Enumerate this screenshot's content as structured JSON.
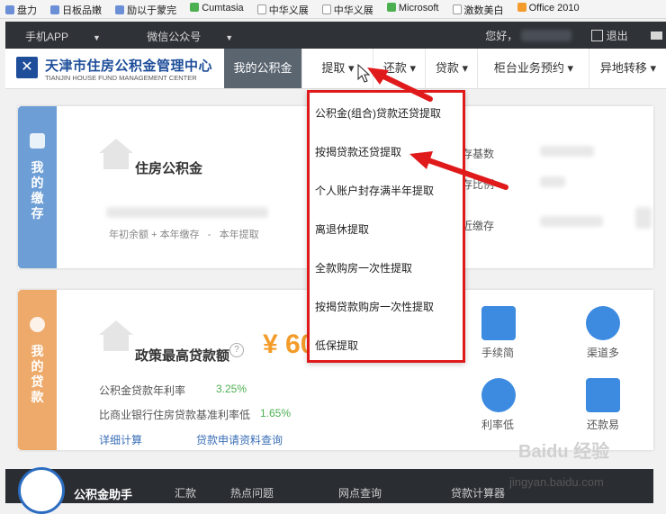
{
  "bookmarks": [
    "盘力",
    "日板品嫩",
    "励以于蒙完",
    "Cumtasia",
    "中华义展",
    "中华义展",
    "Microsoft",
    "激数美白",
    "Office 2010"
  ],
  "topbar": {
    "app_label": "手机APP",
    "wechat_label": "微信公众号",
    "greeting": "您好，",
    "logout_label": "退出"
  },
  "site": {
    "title_cn": "天津市住房公积金管理中心",
    "title_en": "TIANJIN HOUSE FUND MANAGEMENT CENTER"
  },
  "nav": {
    "items": [
      {
        "label": "我的公积金",
        "active": true
      },
      {
        "label": "提取 ▾"
      },
      {
        "label": "还款 ▾"
      },
      {
        "label": "贷款 ▾"
      },
      {
        "label": "柜台业务预约 ▾"
      },
      {
        "label": "异地转移 ▾"
      }
    ]
  },
  "deposit": {
    "tab_label": [
      "我",
      "的",
      "缴",
      "存"
    ],
    "title": "住房公积金",
    "formula": [
      "年初余额",
      "+",
      "本年缴存",
      "-",
      "本年提取"
    ],
    "right_labels": [
      "存基数",
      "存比例",
      "近缴存"
    ]
  },
  "loan": {
    "tab_label": [
      "我",
      "的",
      "贷",
      "款"
    ],
    "title": "政策最高贷款额",
    "info_mark": "?",
    "amount": "¥ 60",
    "rows": [
      {
        "label": "公积金贷款年利率",
        "value": "3.25%"
      },
      {
        "label": "比商业银行住房贷款基准利率低",
        "value": "1.65%"
      }
    ],
    "links": [
      "详细计算",
      "贷款申请资料查询"
    ],
    "features": [
      "手续简",
      "渠道多",
      "利率低",
      "还款易"
    ]
  },
  "dropdown": {
    "items": [
      "公积金(组合)贷款还贷提取",
      "按揭贷款还贷提取",
      "个人账户封存满半年提取",
      "离退休提取",
      "全款购房一次性提取",
      "按揭贷款购房一次性提取",
      "低保提取"
    ]
  },
  "bottombar": {
    "items": [
      "公积金助手",
      "汇款",
      "热点问题",
      "网点查询",
      "贷款计算器"
    ]
  },
  "watermark": {
    "brand": "Baidu 经验",
    "url": "jingyan.baidu.com"
  },
  "colors": {
    "accent_red": "#e0191b",
    "brand_blue": "#1e4e9a",
    "deposit_tab": "#6d9ed6",
    "loan_tab": "#eeaa6a",
    "amount_orange": "#f39c2b",
    "rate_green": "#4caf50"
  }
}
